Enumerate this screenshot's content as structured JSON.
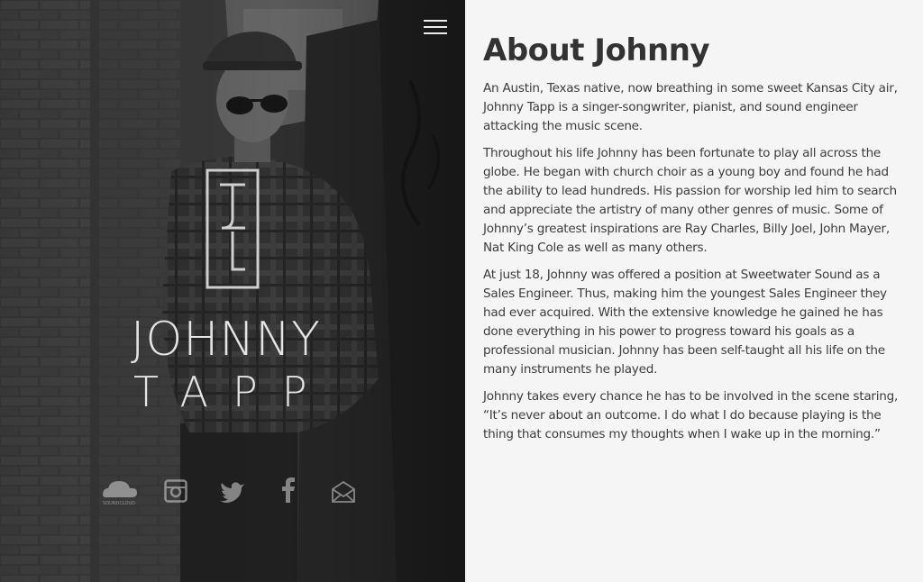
{
  "hero": {
    "first_name": "JOHNNY",
    "last_name": "TAPP",
    "logo_icon": "jtl-monogram-icon",
    "menu_icon": "hamburger-menu-icon",
    "social": [
      {
        "name": "soundcloud",
        "label": "SOUNDCLOUD"
      },
      {
        "name": "instagram"
      },
      {
        "name": "twitter"
      },
      {
        "name": "facebook"
      },
      {
        "name": "email"
      }
    ]
  },
  "about": {
    "title": "About Johnny",
    "paragraphs": [
      "An Austin, Texas native, now breathing in some sweet Kansas City air, Johnny Tapp is a singer-songwriter, pianist, and sound engineer attacking the music scene.",
      "Throughout his life Johnny has been fortunate to play all across the globe. He began with church choir as a young boy and found he had the ability to lead hundreds. His passion for worship led him to search and appreciate the artistry of many other genres of music. Some of Johnny’s greatest inspirations are Ray Charles, Billy Joel, John Mayer, Nat King Cole as well as many others.",
      "At just 18, Johnny was offered a position at Sweetwater Sound as a Sales Engineer. Thus, making him the youngest Sales Engineer they had ever acquired. With the extensive knowledge he gained he has done everything in his power to progress toward his goals as a professional musician. Johnny has been self-taught all his life on the many instruments he played.",
      "Johnny takes every chance he has to be involved in the scene staring, “It’s never about an outcome. I do what I do because playing is the thing that consumes my thoughts when I wake up in the morning.”"
    ]
  },
  "colors": {
    "panel_bg": "#f5f5f5",
    "heading": "#333333",
    "body_text": "#3d3d3d",
    "hero_text": "#e4e4e4"
  }
}
